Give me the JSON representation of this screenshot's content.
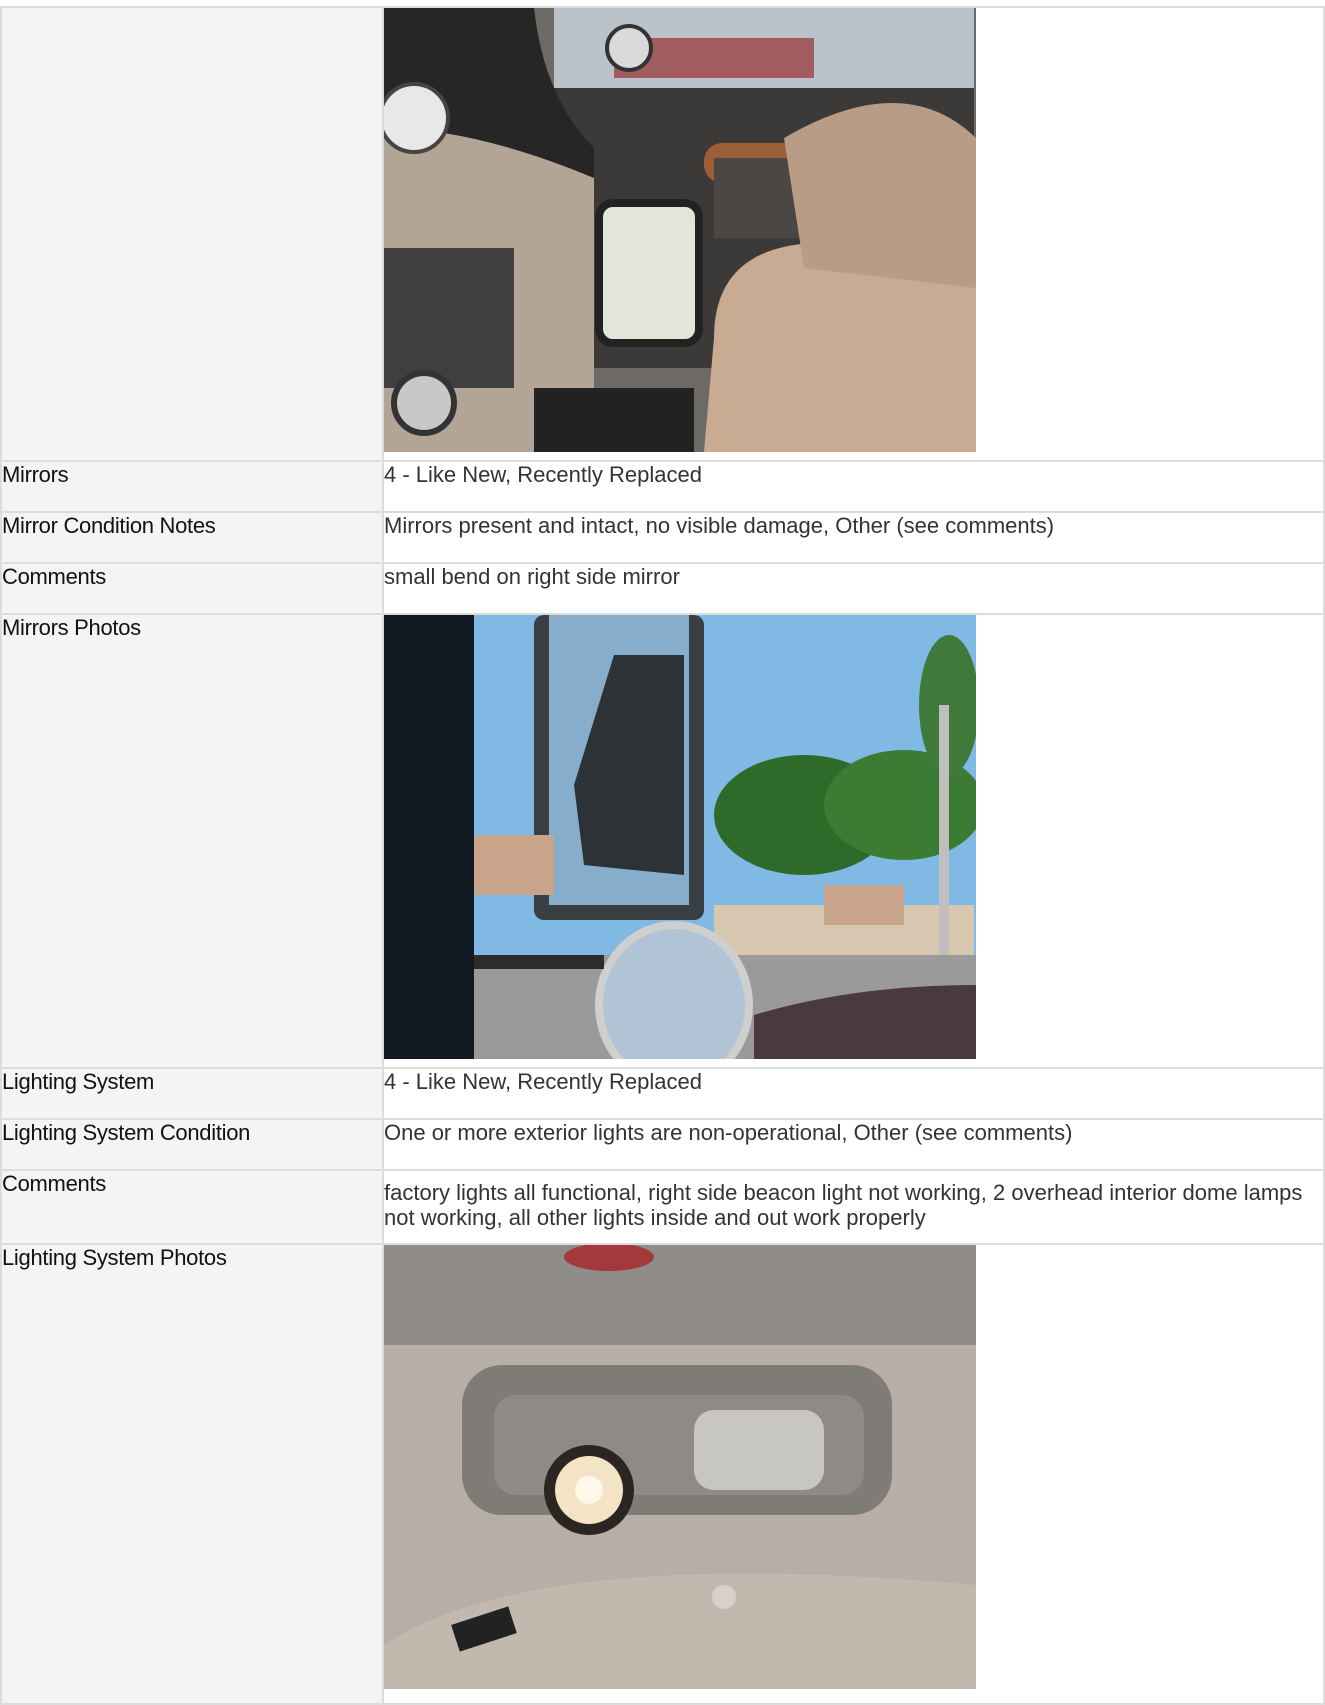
{
  "rows": [
    {
      "label": "",
      "photo": "cab-interior-photo"
    },
    {
      "label": "Mirrors",
      "value": "4 - Like New, Recently Replaced"
    },
    {
      "label": "Mirror Condition Notes",
      "value": "Mirrors present and intact, no visible damage, Other (see comments)"
    },
    {
      "label": "Comments",
      "value": "small bend on right side mirror"
    },
    {
      "label": "Mirrors Photos",
      "photo": "side-mirror-photo"
    },
    {
      "label": "Lighting System",
      "value": "4 - Like New, Recently Replaced"
    },
    {
      "label": "Lighting System Condition",
      "value": "One or more exterior lights are non-operational, Other (see comments)"
    },
    {
      "label": "Comments",
      "value": "factory lights all functional, right side beacon light not working, 2 overhead interior dome lamps not working, all other lights inside and out work properly"
    },
    {
      "label": "Lighting System Photos",
      "photo": "dome-light-photo"
    }
  ]
}
